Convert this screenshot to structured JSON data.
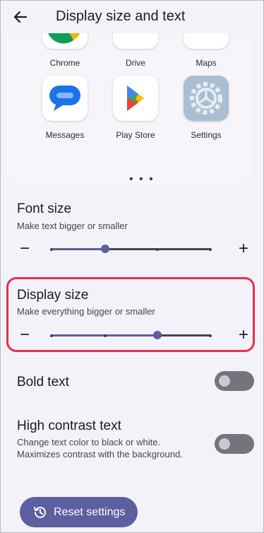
{
  "header": {
    "title": "Display size and text"
  },
  "preview": {
    "apps": [
      {
        "label": "Chrome",
        "icon": "chrome-icon"
      },
      {
        "label": "Drive",
        "icon": "drive-icon"
      },
      {
        "label": "Maps",
        "icon": "maps-icon"
      },
      {
        "label": "Messages",
        "icon": "messages-icon"
      },
      {
        "label": "Play Store",
        "icon": "play-store-icon"
      },
      {
        "label": "Settings",
        "icon": "settings-icon"
      }
    ],
    "more_dots": "• • •"
  },
  "font_size": {
    "title": "Font size",
    "subtitle": "Make text bigger or smaller",
    "minus": "−",
    "plus": "+",
    "steps": 4,
    "selected_index": 1
  },
  "display_size": {
    "title": "Display size",
    "subtitle": "Make everything bigger or smaller",
    "minus": "−",
    "plus": "+",
    "steps": 4,
    "selected_index": 2
  },
  "bold_text": {
    "title": "Bold text",
    "enabled": false
  },
  "high_contrast": {
    "title": "High contrast text",
    "subtitle": "Change text color to black or white. Maximizes contrast with the background.",
    "enabled": false
  },
  "reset_button": {
    "label": "Reset settings",
    "icon": "history-icon"
  },
  "colors": {
    "accent": "#5d5f97",
    "highlight_border": "#e0334f",
    "background": "#f3f2f9"
  }
}
